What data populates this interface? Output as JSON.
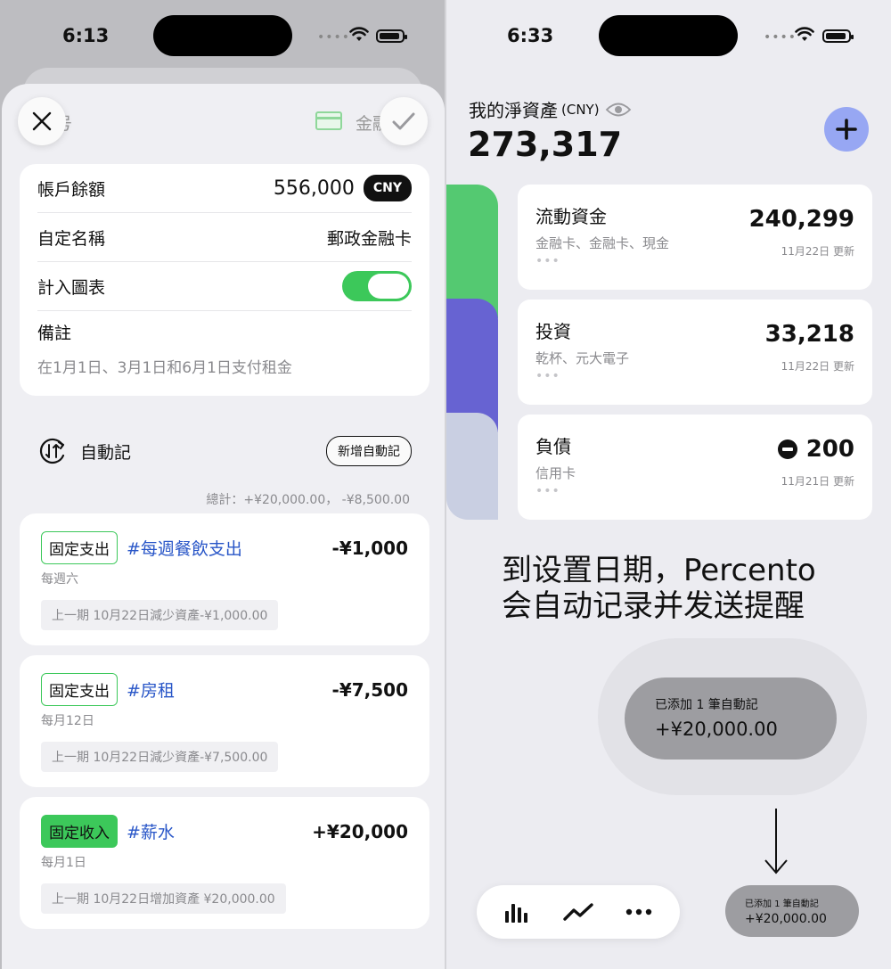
{
  "left": {
    "status": {
      "time": "6:13"
    },
    "header": {
      "title_partial": "号",
      "category_partial": "金融"
    },
    "account": {
      "balance_label": "帳戶餘額",
      "balance_value": "556,000",
      "currency": "CNY",
      "name_label": "自定名稱",
      "name_value": "郵政金融卡",
      "chart_label": "計入圖表",
      "chart_enabled": true,
      "note_label": "備註",
      "note_text": "在1月1日、3月1日和6月1日支付租金"
    },
    "auto": {
      "title": "自動記",
      "add_button": "新增自動記",
      "total": "總計：+¥20,000.00， -¥8,500.00"
    },
    "transactions": [
      {
        "tag": "固定支出",
        "hashtag": "#每週餐飲支出",
        "amount": "-¥1,000",
        "freq": "每週六",
        "last": "上一期 10月22日減少資產-¥1,000.00"
      },
      {
        "tag": "固定支出",
        "hashtag": "#房租",
        "amount": "-¥7,500",
        "freq": "每月12日",
        "last": "上一期 10月22日減少資產-¥7,500.00"
      },
      {
        "tag": "固定收入",
        "hashtag": "#薪水",
        "amount": "+¥20,000",
        "freq": "每月1日",
        "last": "上一期 10月22日增加資產 ¥20,000.00"
      }
    ]
  },
  "right": {
    "status": {
      "time": "6:33"
    },
    "net_worth": {
      "label": "我的淨資產",
      "currency": "(CNY)",
      "value": "273,317"
    },
    "accounts": [
      {
        "name": "流動資金",
        "sub": "金融卡、金融卡、現金",
        "amount": "240,299",
        "updated": "11月22日 更新"
      },
      {
        "name": "投資",
        "sub": "乾杯、元大電子",
        "amount": "33,218",
        "updated": "11月22日 更新"
      },
      {
        "name": "負債",
        "sub": "信用卡",
        "amount": "200",
        "updated": "11月21日 更新"
      }
    ],
    "more": "•••",
    "caption_line1": "到设置日期，Percento",
    "caption_line2": "会自动记录并发送提醒",
    "toast": {
      "title": "已添加 1 筆自動記",
      "amount": "+¥20,000.00"
    },
    "colors": {
      "liquid": "#54c971",
      "invest": "#6763d2",
      "debt": "#c9cfe2",
      "accent": "#97a7f3"
    }
  }
}
